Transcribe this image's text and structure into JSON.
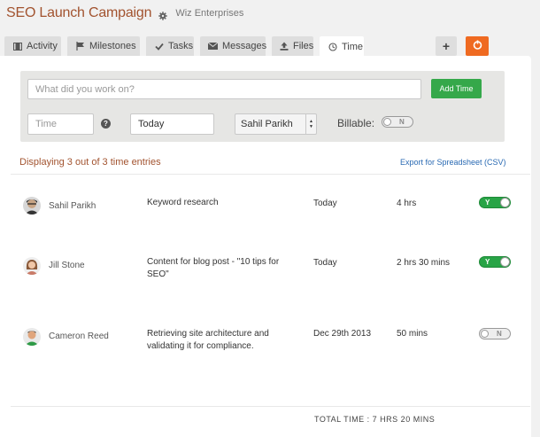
{
  "header": {
    "project_title": "SEO Launch Campaign",
    "company": "Wiz Enterprises"
  },
  "tabs": [
    {
      "label": "Activity",
      "icon": "film-icon"
    },
    {
      "label": "Milestones",
      "icon": "flag-icon"
    },
    {
      "label": "Tasks",
      "icon": "check-icon"
    },
    {
      "label": "Messages",
      "icon": "envelope-icon"
    },
    {
      "label": "Files",
      "icon": "upload-icon"
    },
    {
      "label": "Time",
      "icon": "clock-icon",
      "active": true
    }
  ],
  "actions": {
    "plus": "+",
    "accent_color": "#ef6a21"
  },
  "form": {
    "work_placeholder": "What did you work on?",
    "time_placeholder": "Time",
    "date_value": "Today",
    "user_value": "Sahil Parikh",
    "billable_label": "Billable:",
    "billable_toggle": "N",
    "add_button": "Add Time",
    "add_button_color": "#35a84a"
  },
  "summary": "Displaying 3 out of 3 time entries",
  "export_link": "Export for Spreadsheet (CSV)",
  "entries": [
    {
      "name": "Sahil Parikh",
      "description": "Keyword research",
      "date": "Today",
      "duration": "4 hrs",
      "billable": "Y"
    },
    {
      "name": "Jill Stone",
      "description": "Content for blog post - \"10 tips for SEO\"",
      "date": "Today",
      "duration": "2 hrs 30 mins",
      "billable": "Y"
    },
    {
      "name": "Cameron Reed",
      "description": "Retrieving site architecture and validating it for compliance.",
      "date": "Dec 29th 2013",
      "duration": "50 mins",
      "billable": "N"
    }
  ],
  "total": "TOTAL TIME : 7 HRS 20 MINS"
}
